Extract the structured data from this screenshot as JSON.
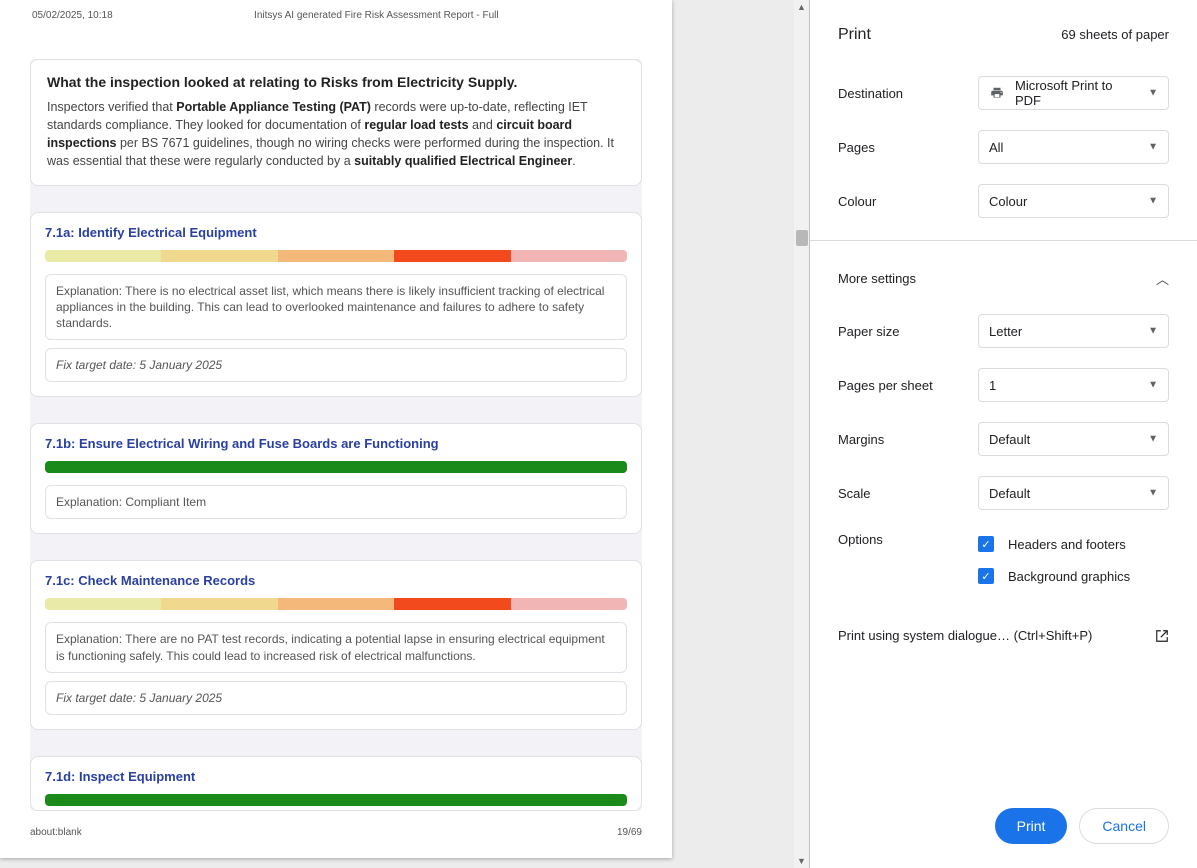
{
  "preview": {
    "header_left": "05/02/2025, 10:18",
    "header_center": "Initsys AI generated Fire Risk Assessment Report - Full",
    "footer_left": "about:blank",
    "footer_right": "19/69",
    "intro": {
      "title": "What the inspection looked at relating to Risks from Electricity Supply.",
      "p1a": "Inspectors verified that ",
      "p1b": "Portable Appliance Testing (PAT)",
      "p1c": " records were up-to-date, reflecting IET standards compliance. They looked for documentation of ",
      "p1d": "regular load tests",
      "p1e": " and ",
      "p1f": "circuit board inspections",
      "p1g": " per BS 7671 guidelines, though no wiring checks were performed during the inspection. It was essential that these were regularly conducted by a ",
      "p1h": "suitably qualified Electrical Engineer",
      "p1i": "."
    },
    "items": [
      {
        "title": "7.1a: Identify Electrical Equipment",
        "bar": "multi",
        "explanation": "Explanation: There is no electrical asset list, which means there is likely insufficient tracking of electrical appliances in the building. This can lead to overlooked maintenance and failures to adhere to safety standards.",
        "fix": "Fix target date: 5 January 2025"
      },
      {
        "title": "7.1b: Ensure Electrical Wiring and Fuse Boards are Functioning",
        "bar": "green",
        "explanation": "Explanation: Compliant Item",
        "fix": ""
      },
      {
        "title": "7.1c: Check Maintenance Records",
        "bar": "multi",
        "explanation": "Explanation: There are no PAT test records, indicating a potential lapse in ensuring electrical equipment is functioning safely. This could lead to increased risk of electrical malfunctions.",
        "fix": "Fix target date: 5 January 2025"
      },
      {
        "title": "7.1d: Inspect Equipment",
        "bar": "green",
        "explanation": "",
        "fix": ""
      }
    ]
  },
  "panel": {
    "title": "Print",
    "sheets": "69 sheets of paper",
    "destination_label": "Destination",
    "destination_value": "Microsoft Print to PDF",
    "pages_label": "Pages",
    "pages_value": "All",
    "colour_label": "Colour",
    "colour_value": "Colour",
    "more_settings": "More settings",
    "paper_size_label": "Paper size",
    "paper_size_value": "Letter",
    "pps_label": "Pages per sheet",
    "pps_value": "1",
    "margins_label": "Margins",
    "margins_value": "Default",
    "scale_label": "Scale",
    "scale_value": "Default",
    "options_label": "Options",
    "opt_headers": "Headers and footers",
    "opt_background": "Background graphics",
    "system_dialog": "Print using system dialogue… (Ctrl+Shift+P)",
    "print_btn": "Print",
    "cancel_btn": "Cancel"
  }
}
